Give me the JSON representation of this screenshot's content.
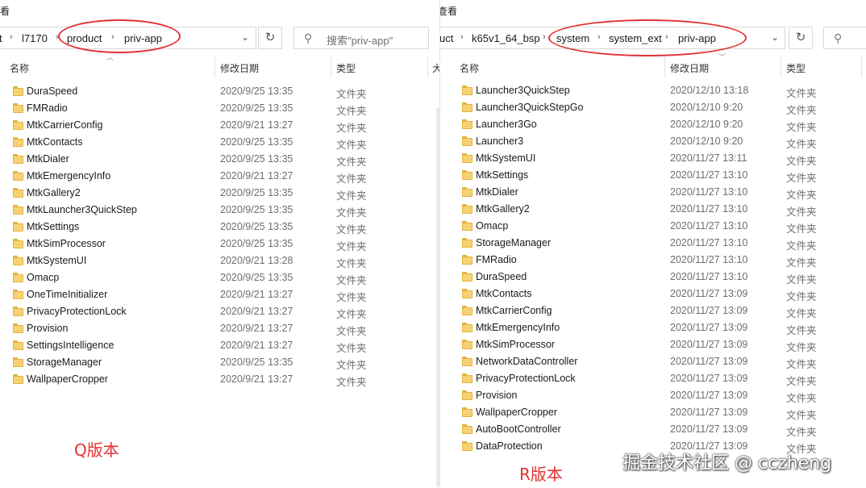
{
  "left": {
    "view_label": "看",
    "breadcrumb": [
      "t",
      "l7170",
      "product",
      "priv-app"
    ],
    "search_placeholder": "搜索\"priv-app\"",
    "columns": {
      "name": "名称",
      "date": "修改日期",
      "type": "类型",
      "extra": "大"
    },
    "rows": [
      {
        "name": "DuraSpeed",
        "date": "2020/9/25 13:35",
        "type": "文件夹"
      },
      {
        "name": "FMRadio",
        "date": "2020/9/25 13:35",
        "type": "文件夹"
      },
      {
        "name": "MtkCarrierConfig",
        "date": "2020/9/21 13:27",
        "type": "文件夹"
      },
      {
        "name": "MtkContacts",
        "date": "2020/9/25 13:35",
        "type": "文件夹"
      },
      {
        "name": "MtkDialer",
        "date": "2020/9/25 13:35",
        "type": "文件夹"
      },
      {
        "name": "MtkEmergencyInfo",
        "date": "2020/9/21 13:27",
        "type": "文件夹"
      },
      {
        "name": "MtkGallery2",
        "date": "2020/9/25 13:35",
        "type": "文件夹"
      },
      {
        "name": "MtkLauncher3QuickStep",
        "date": "2020/9/25 13:35",
        "type": "文件夹"
      },
      {
        "name": "MtkSettings",
        "date": "2020/9/25 13:35",
        "type": "文件夹"
      },
      {
        "name": "MtkSimProcessor",
        "date": "2020/9/25 13:35",
        "type": "文件夹"
      },
      {
        "name": "MtkSystemUI",
        "date": "2020/9/21 13:28",
        "type": "文件夹"
      },
      {
        "name": "Omacp",
        "date": "2020/9/25 13:35",
        "type": "文件夹"
      },
      {
        "name": "OneTimeInitializer",
        "date": "2020/9/21 13:27",
        "type": "文件夹"
      },
      {
        "name": "PrivacyProtectionLock",
        "date": "2020/9/21 13:27",
        "type": "文件夹"
      },
      {
        "name": "Provision",
        "date": "2020/9/21 13:27",
        "type": "文件夹"
      },
      {
        "name": "SettingsIntelligence",
        "date": "2020/9/21 13:27",
        "type": "文件夹"
      },
      {
        "name": "StorageManager",
        "date": "2020/9/25 13:35",
        "type": "文件夹"
      },
      {
        "name": "WallpaperCropper",
        "date": "2020/9/21 13:27",
        "type": "文件夹"
      }
    ],
    "caption": "Q版本"
  },
  "right": {
    "view_label": "查看",
    "breadcrumb": [
      "uct",
      "k65v1_64_bsp",
      "system",
      "system_ext",
      "priv-app"
    ],
    "columns": {
      "name": "名称",
      "date": "修改日期",
      "type": "类型"
    },
    "rows": [
      {
        "name": "Launcher3QuickStep",
        "date": "2020/12/10 13:18",
        "type": "文件夹"
      },
      {
        "name": "Launcher3QuickStepGo",
        "date": "2020/12/10 9:20",
        "type": "文件夹"
      },
      {
        "name": "Launcher3Go",
        "date": "2020/12/10 9:20",
        "type": "文件夹"
      },
      {
        "name": "Launcher3",
        "date": "2020/12/10 9:20",
        "type": "文件夹"
      },
      {
        "name": "MtkSystemUI",
        "date": "2020/11/27 13:11",
        "type": "文件夹"
      },
      {
        "name": "MtkSettings",
        "date": "2020/11/27 13:10",
        "type": "文件夹"
      },
      {
        "name": "MtkDialer",
        "date": "2020/11/27 13:10",
        "type": "文件夹"
      },
      {
        "name": "MtkGallery2",
        "date": "2020/11/27 13:10",
        "type": "文件夹"
      },
      {
        "name": "Omacp",
        "date": "2020/11/27 13:10",
        "type": "文件夹"
      },
      {
        "name": "StorageManager",
        "date": "2020/11/27 13:10",
        "type": "文件夹"
      },
      {
        "name": "FMRadio",
        "date": "2020/11/27 13:10",
        "type": "文件夹"
      },
      {
        "name": "DuraSpeed",
        "date": "2020/11/27 13:10",
        "type": "文件夹"
      },
      {
        "name": "MtkContacts",
        "date": "2020/11/27 13:09",
        "type": "文件夹"
      },
      {
        "name": "MtkCarrierConfig",
        "date": "2020/11/27 13:09",
        "type": "文件夹"
      },
      {
        "name": "MtkEmergencyInfo",
        "date": "2020/11/27 13:09",
        "type": "文件夹"
      },
      {
        "name": "MtkSimProcessor",
        "date": "2020/11/27 13:09",
        "type": "文件夹"
      },
      {
        "name": "NetworkDataController",
        "date": "2020/11/27 13:09",
        "type": "文件夹"
      },
      {
        "name": "PrivacyProtectionLock",
        "date": "2020/11/27 13:09",
        "type": "文件夹"
      },
      {
        "name": "Provision",
        "date": "2020/11/27 13:09",
        "type": "文件夹"
      },
      {
        "name": "WallpaperCropper",
        "date": "2020/11/27 13:09",
        "type": "文件夹"
      },
      {
        "name": "AutoBootController",
        "date": "2020/11/27 13:09",
        "type": "文件夹"
      },
      {
        "name": "DataProtection",
        "date": "2020/11/27 13:09",
        "type": "文件夹"
      }
    ],
    "caption": "R版本"
  },
  "watermark": "掘金技术社区 @ cczheng",
  "colors": {
    "annotation_red": "#e23131",
    "folder_yellow": "#f7d275",
    "date_gray": "#6d6d6d"
  },
  "icons": {
    "refresh": "refresh-icon",
    "search": "search-icon",
    "folder": "folder-icon",
    "chevron": "chevron-right-icon",
    "dropdown": "chevron-down-icon",
    "help": "help-icon"
  }
}
